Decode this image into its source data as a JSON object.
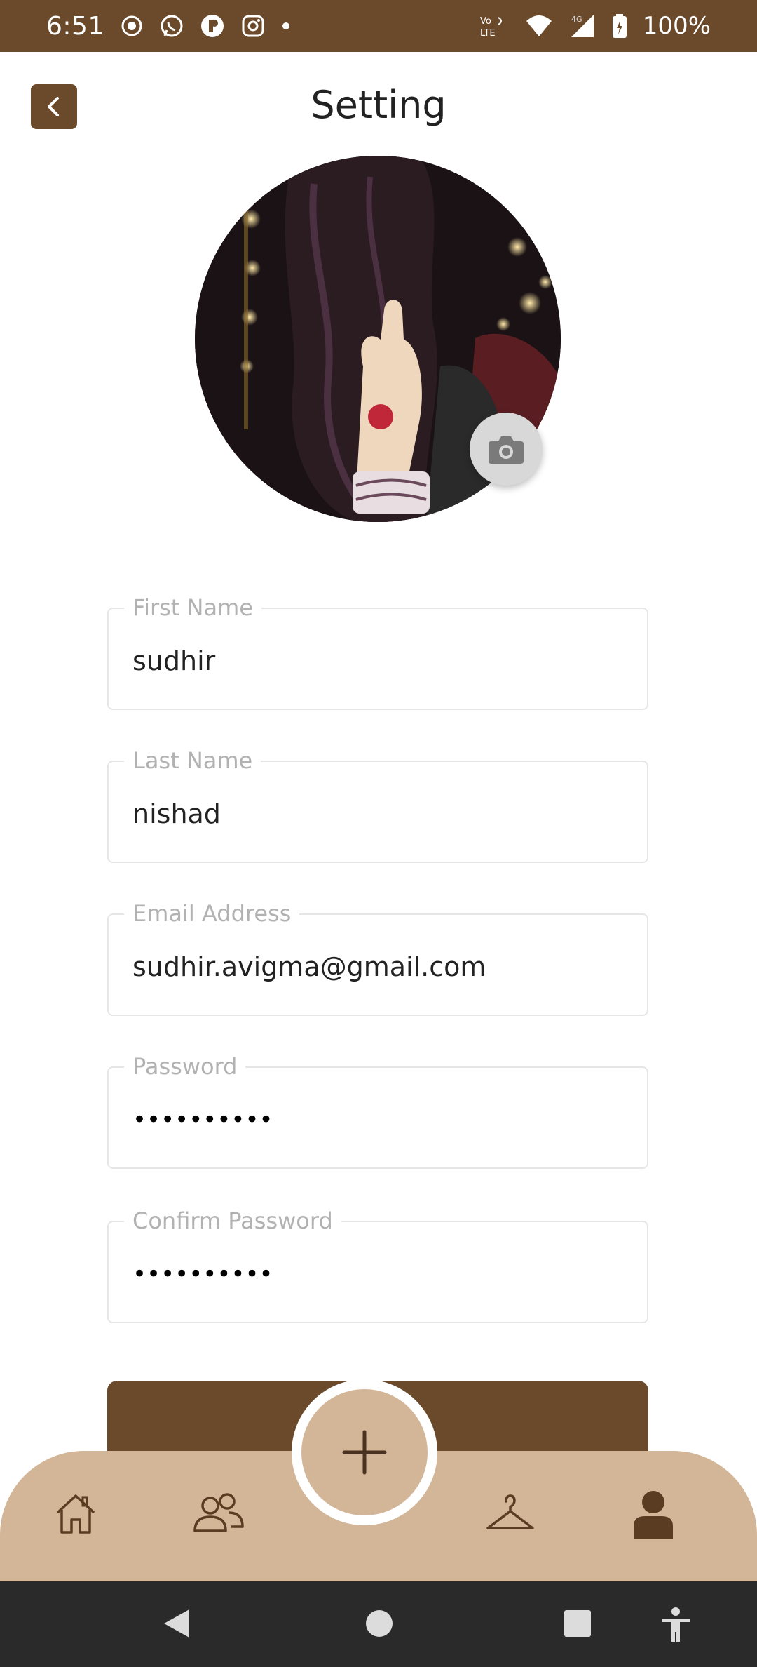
{
  "status_bar": {
    "time": "6:51",
    "battery_text": "100%",
    "network_text": "Vo LTE",
    "signal_type": "4G",
    "icons_left": [
      "screen-record-icon",
      "whatsapp-icon",
      "app-icon",
      "instagram-icon",
      "dot-icon"
    ],
    "icons_right": [
      "volte-icon",
      "wifi-icon",
      "signal-icon",
      "battery-icon"
    ]
  },
  "header": {
    "title": "Setting",
    "back_icon": "chevron-left-icon"
  },
  "avatar": {
    "camera_icon": "camera-icon"
  },
  "form": {
    "first_name": {
      "label": "First Name",
      "value": "sudhir"
    },
    "last_name": {
      "label": "Last Name",
      "value": "nishad"
    },
    "email": {
      "label": "Email Address",
      "value": "sudhir.avigma@gmail.com"
    },
    "password": {
      "label": "Password",
      "value": "••••••••••"
    },
    "confirm_password": {
      "label": "Confirm Password",
      "value": "••••••••••"
    }
  },
  "bottom_nav": {
    "items": [
      "home-icon",
      "users-icon",
      "add-icon",
      "hanger-icon",
      "profile-icon"
    ],
    "active": "profile-icon"
  },
  "colors": {
    "brand_brown": "#6b4a2b",
    "nav_tan": "#d3b598",
    "system_nav": "#2a2a2a"
  }
}
